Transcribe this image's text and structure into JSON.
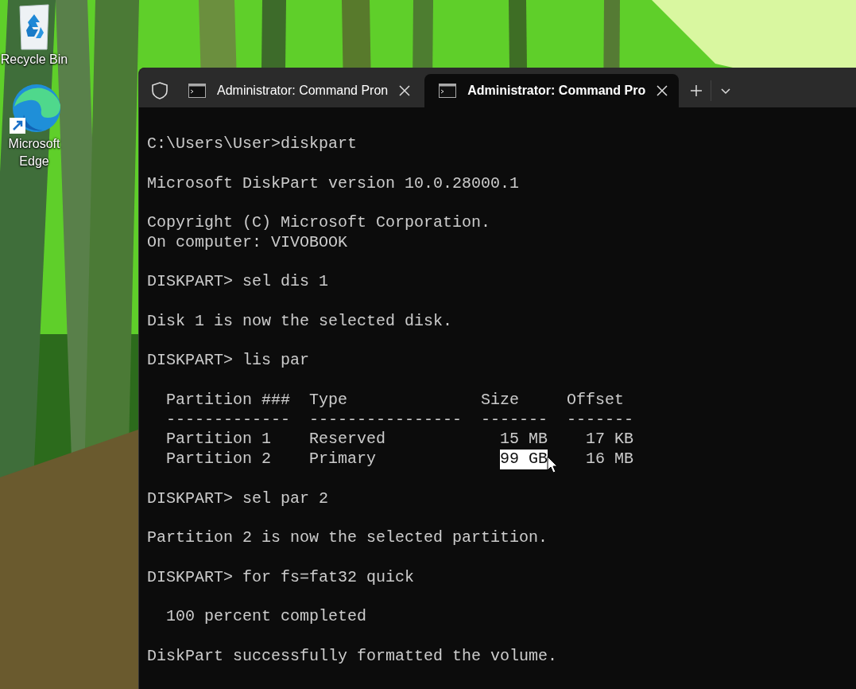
{
  "desktop_icons": [
    {
      "label": "Recycle Bin",
      "kind": "recycle"
    },
    {
      "label": "Microsoft Edge",
      "kind": "edge"
    }
  ],
  "window": {
    "tabs": [
      {
        "title": "Administrator: Command Pron",
        "selected": false
      },
      {
        "title": "Administrator: Command Pro",
        "selected": true
      }
    ],
    "terminal": {
      "blocks": [
        [
          "C:\\Users\\User>diskpart"
        ],
        [
          "Microsoft DiskPart version 10.0.28000.1"
        ],
        [
          "Copyright (C) Microsoft Corporation.",
          "On computer: VIVOBOOK"
        ],
        [
          "DISKPART> sel dis 1"
        ],
        [
          "Disk 1 is now the selected disk."
        ],
        [
          "DISKPART> lis par"
        ],
        [
          "  Partition ###  Type              Size     Offset",
          "  -------------  ----------------  -------  -------",
          "  Partition 1    Reserved            15 MB    17 KB",
          {
            "segments": [
              {
                "text": "  Partition 2    Primary             ",
                "selected": false
              },
              {
                "text": "99 GB",
                "selected": true
              },
              {
                "text": "    16 MB",
                "selected": false
              }
            ]
          }
        ],
        [
          "DISKPART> sel par 2"
        ],
        [
          "Partition 2 is now the selected partition."
        ],
        [
          "DISKPART> for fs=fat32 quick"
        ],
        [
          "  100 percent completed"
        ],
        [
          "DiskPart successfully formatted the volume."
        ]
      ]
    }
  }
}
